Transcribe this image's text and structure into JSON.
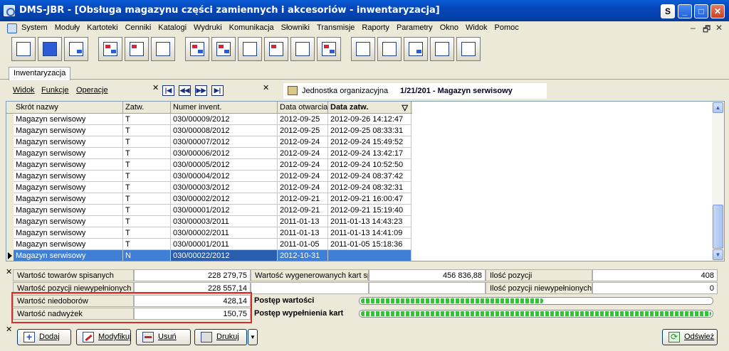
{
  "window": {
    "title": "DMS-JBR - [Obsługa magazynu części zamiennych i akcesoriów - inwentaryzacja]",
    "btn_s": "S",
    "min": "_",
    "max": "□",
    "close": "✕"
  },
  "menu": [
    "System",
    "Moduły",
    "Kartoteki",
    "Cenniki",
    "Katalogi",
    "Wydruki",
    "Komunikacja",
    "Słowniki",
    "Transmisje",
    "Raporty",
    "Parametry",
    "Okno",
    "Widok",
    "Pomoc"
  ],
  "mdi": {
    "min": "–",
    "restore": "🗗",
    "close": "✕"
  },
  "tab": {
    "label": "Inwentaryzacja"
  },
  "local_menu": {
    "widok": "Widok",
    "funkcje": "Funkcje",
    "operacje": "Operacje",
    "close": "✕"
  },
  "nav": {
    "first": "|◀",
    "prev": "◀◀",
    "next": "▶▶",
    "last": "▶|",
    "close": "✕"
  },
  "org": {
    "label": "Jednostka organizacyjna",
    "value": "1/21/201 - Magazyn serwisowy"
  },
  "grid": {
    "columns": [
      "Skrót nazwy",
      "Zatw.",
      "Numer invent.",
      "Data otwarcia",
      "Data zatw."
    ],
    "sort_icon": "▽",
    "rows": [
      [
        "Magazyn serwisowy",
        "T",
        "030/00009/2012",
        "2012-09-25",
        "2012-09-26 14:12:47"
      ],
      [
        "Magazyn serwisowy",
        "T",
        "030/00008/2012",
        "2012-09-25",
        "2012-09-25 08:33:31"
      ],
      [
        "Magazyn serwisowy",
        "T",
        "030/00007/2012",
        "2012-09-24",
        "2012-09-24 15:49:52"
      ],
      [
        "Magazyn serwisowy",
        "T",
        "030/00006/2012",
        "2012-09-24",
        "2012-09-24 13:42:17"
      ],
      [
        "Magazyn serwisowy",
        "T",
        "030/00005/2012",
        "2012-09-24",
        "2012-09-24 10:52:50"
      ],
      [
        "Magazyn serwisowy",
        "T",
        "030/00004/2012",
        "2012-09-24",
        "2012-09-24 08:37:42"
      ],
      [
        "Magazyn serwisowy",
        "T",
        "030/00003/2012",
        "2012-09-24",
        "2012-09-24 08:32:31"
      ],
      [
        "Magazyn serwisowy",
        "T",
        "030/00002/2012",
        "2012-09-21",
        "2012-09-21 16:00:47"
      ],
      [
        "Magazyn serwisowy",
        "T",
        "030/00001/2012",
        "2012-09-21",
        "2012-09-21 15:19:40"
      ],
      [
        "Magazyn serwisowy",
        "T",
        "030/00003/2011",
        "2011-01-13",
        "2011-01-13 14:43:23"
      ],
      [
        "Magazyn serwisowy",
        "T",
        "030/00002/2011",
        "2011-01-13",
        "2011-01-13 14:41:09"
      ],
      [
        "Magazyn serwisowy",
        "T",
        "030/00001/2011",
        "2011-01-05",
        "2011-01-05 15:18:36"
      ],
      [
        "Magazyn serwisowy",
        "N",
        "030/00022/2012",
        "2012-10-31",
        ""
      ]
    ],
    "selected_row": 12,
    "scroll_up": "▲",
    "scroll_down": "▼"
  },
  "summary": {
    "close": "✕",
    "wartosc_towarow_spisanych": {
      "label": "Wartość towarów spisanych",
      "value": "228 279,75"
    },
    "wartosc_pozycji_niewypelnionych": {
      "label": "Wartość pozycji niewypełnionych",
      "value": "228 557,14"
    },
    "wartosc_niedoborow": {
      "label": "Wartość niedoborów",
      "value": "428,14"
    },
    "wartosc_nadwyzek": {
      "label": "Wartość nadwyżek",
      "value": "150,75"
    },
    "wartosc_kart": {
      "label": "Wartość wygenerowanych kart sp",
      "value": "456 836,88"
    },
    "ilosc_pozycji": {
      "label": "Ilość pozycji",
      "value": "408"
    },
    "ilosc_pozycji_niewypelnionych": {
      "label": "Ilość pozycji niewypełnionych",
      "value": "0"
    },
    "postep_wartosci": {
      "label": "Postęp wartości",
      "progress": 0.52
    },
    "postep_wypelnienia": {
      "label": "Postęp wypełnienia kart",
      "progress": 1.0
    }
  },
  "buttons": {
    "close": "✕",
    "dodaj": "Dodaj",
    "modyfikuj": "Modyfikuj",
    "usun": "Usuń",
    "drukuj": "Drukuj",
    "dropdown": "▼",
    "odswiez": "Odśwież"
  },
  "colors": {
    "selection": "#3f7fd6",
    "highlight_border": "#d0312d",
    "progress": "#36c236",
    "titlebar": "#0646b8"
  }
}
